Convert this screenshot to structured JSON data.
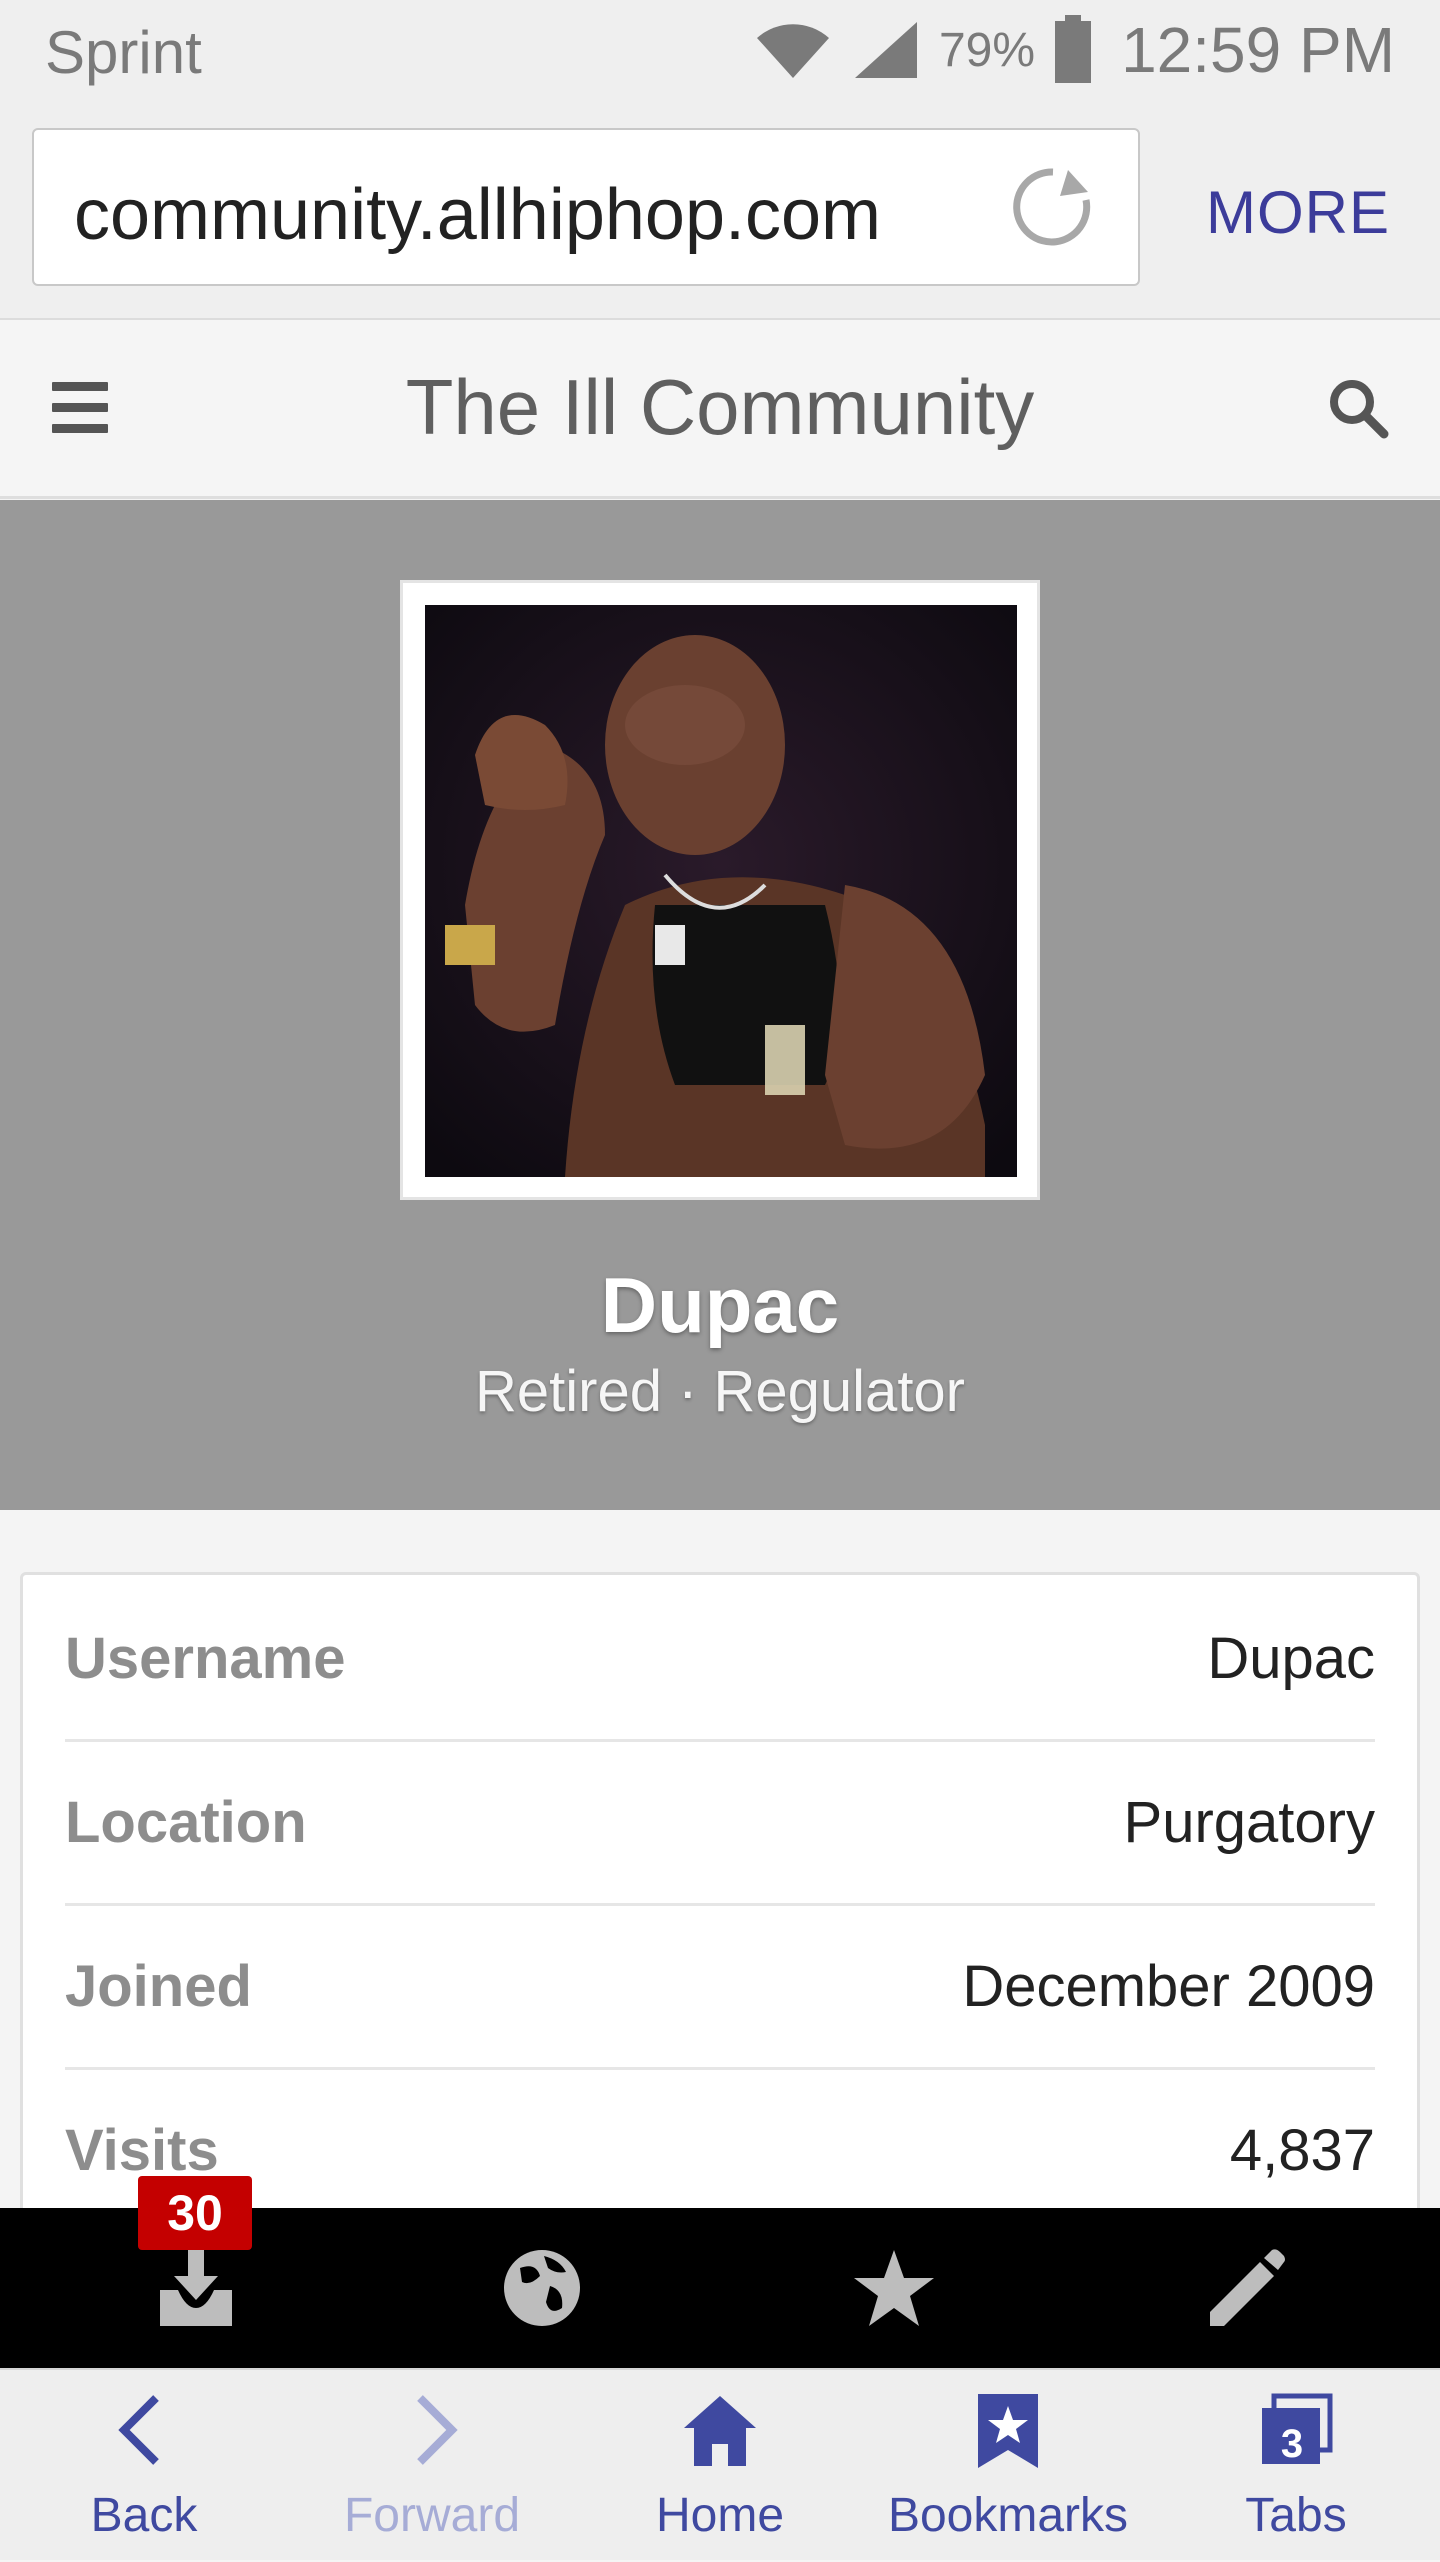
{
  "status_bar": {
    "carrier": "Sprint",
    "battery": "79%",
    "time": "12:59 PM"
  },
  "browser": {
    "url": "community.allhiphop.com",
    "more_label": "MORE"
  },
  "site": {
    "title": "The Ill Community"
  },
  "profile": {
    "name": "Dupac",
    "subtitle": "Retired · Regulator"
  },
  "info": [
    {
      "label": "Username",
      "value": "Dupac"
    },
    {
      "label": "Location",
      "value": "Purgatory"
    },
    {
      "label": "Joined",
      "value": "December 2009"
    },
    {
      "label": "Visits",
      "value": "4,837"
    }
  ],
  "toolbar": {
    "inbox_badge": "30",
    "icons": [
      "inbox-download-icon",
      "globe-icon",
      "star-icon",
      "pencil-icon"
    ]
  },
  "bottom_nav": {
    "back": "Back",
    "forward": "Forward",
    "home": "Home",
    "bookmarks": "Bookmarks",
    "tabs": "Tabs",
    "tabs_count": "3"
  },
  "colors": {
    "accent": "#3f49a0",
    "banner": "#999999",
    "badge": "#c40000"
  }
}
